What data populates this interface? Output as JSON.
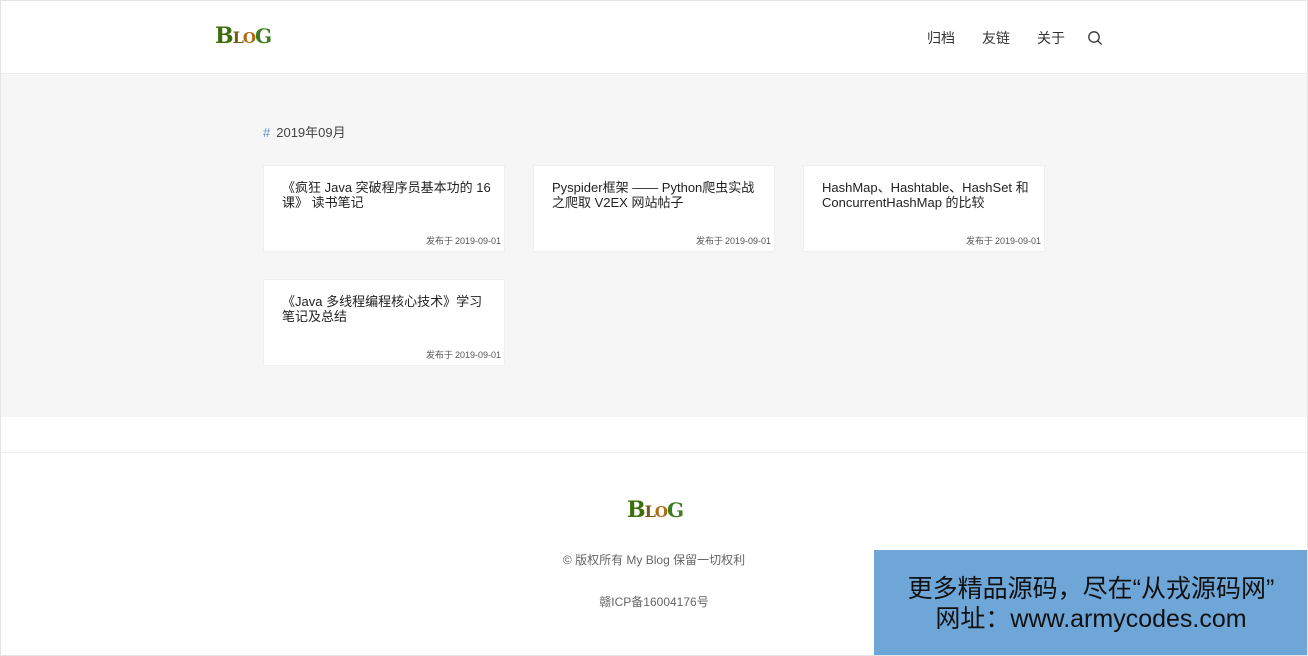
{
  "header": {
    "logo_text": {
      "b": "B",
      "l": "L",
      "o": "O",
      "g": "G"
    },
    "nav": [
      {
        "label": "归档"
      },
      {
        "label": "友链"
      },
      {
        "label": "关于"
      }
    ],
    "search_icon": "search-icon"
  },
  "archive": {
    "hash": "#",
    "month": "2019年09月",
    "posts": [
      {
        "title": "《疯狂 Java 突破程序员基本功的 16 课》 读书笔记",
        "date_prefix": "发布于",
        "date": "2019-09-01"
      },
      {
        "title": "Pyspider框架 —— Python爬虫实战之爬取 V2EX 网站帖子",
        "date_prefix": "发布于",
        "date": "2019-09-01"
      },
      {
        "title": "HashMap、Hashtable、HashSet 和 ConcurrentHashMap 的比较",
        "date_prefix": "发布于",
        "date": "2019-09-01"
      },
      {
        "title": "《Java 多线程编程核心技术》学习笔记及总结",
        "date_prefix": "发布于",
        "date": "2019-09-01"
      }
    ]
  },
  "footer": {
    "copyright": "© 版权所有 My Blog 保留一切权利",
    "icp": "赣ICP备16004176号"
  },
  "banner": {
    "line1": "更多精品源码，尽在“从戎源码网”",
    "line2": "网址：www.armycodes.com"
  },
  "colors": {
    "accent": "#5b8fd9",
    "main_bg": "#f6f6f6",
    "banner_bg": "#6fa6d8"
  }
}
